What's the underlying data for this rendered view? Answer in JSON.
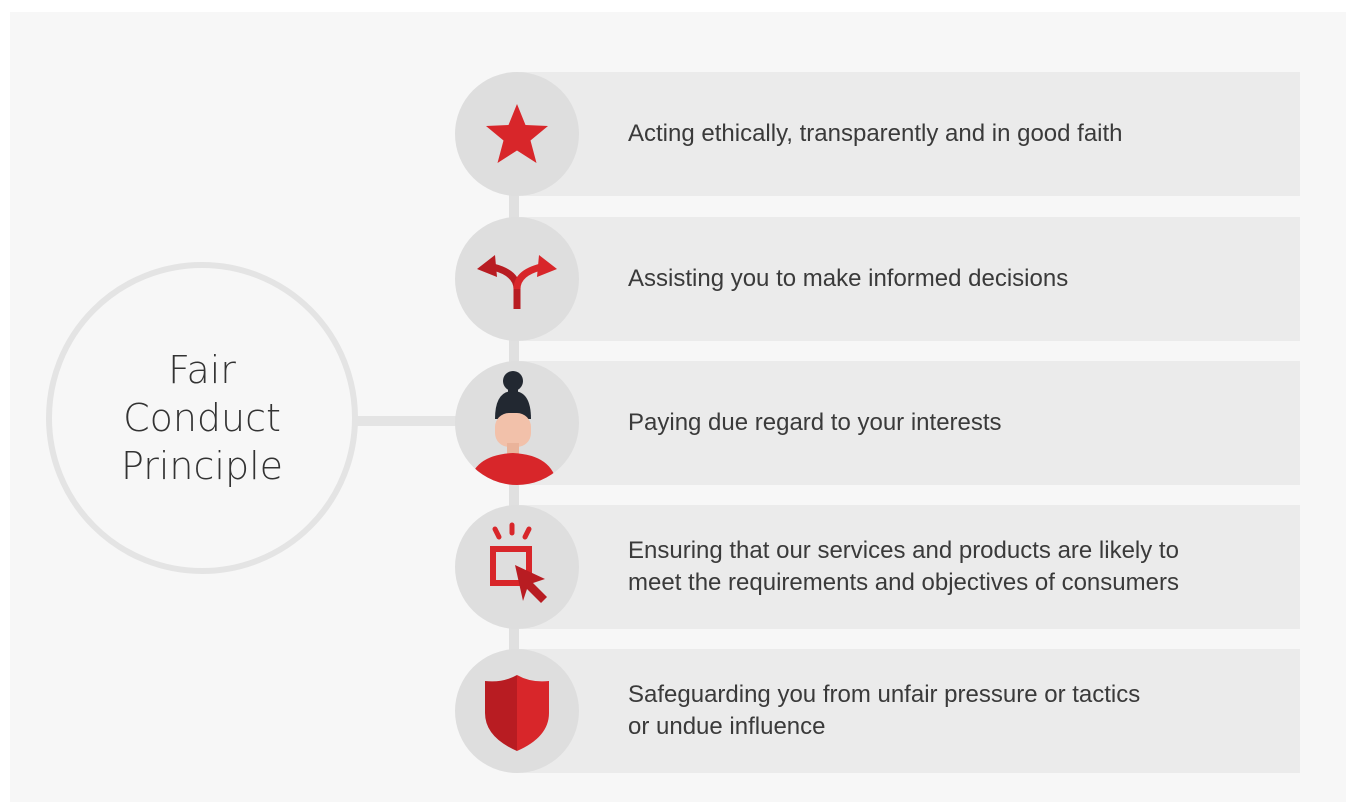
{
  "diagram": {
    "title": "Fair\nConduct\nPrinciple",
    "accent_color": "#d8262a",
    "items": [
      {
        "icon": "star-icon",
        "label": "Acting ethically, transparently and in good faith"
      },
      {
        "icon": "split-arrows-icon",
        "label": "Assisting you to make informed decisions"
      },
      {
        "icon": "person-icon",
        "label": "Paying due regard to your interests"
      },
      {
        "icon": "cursor-click-icon",
        "label": "Ensuring that our services and products are likely to\nmeet the requirements and objectives of consumers"
      },
      {
        "icon": "shield-icon",
        "label": "Safeguarding you from unfair pressure or tactics\nor undue influence"
      }
    ]
  }
}
